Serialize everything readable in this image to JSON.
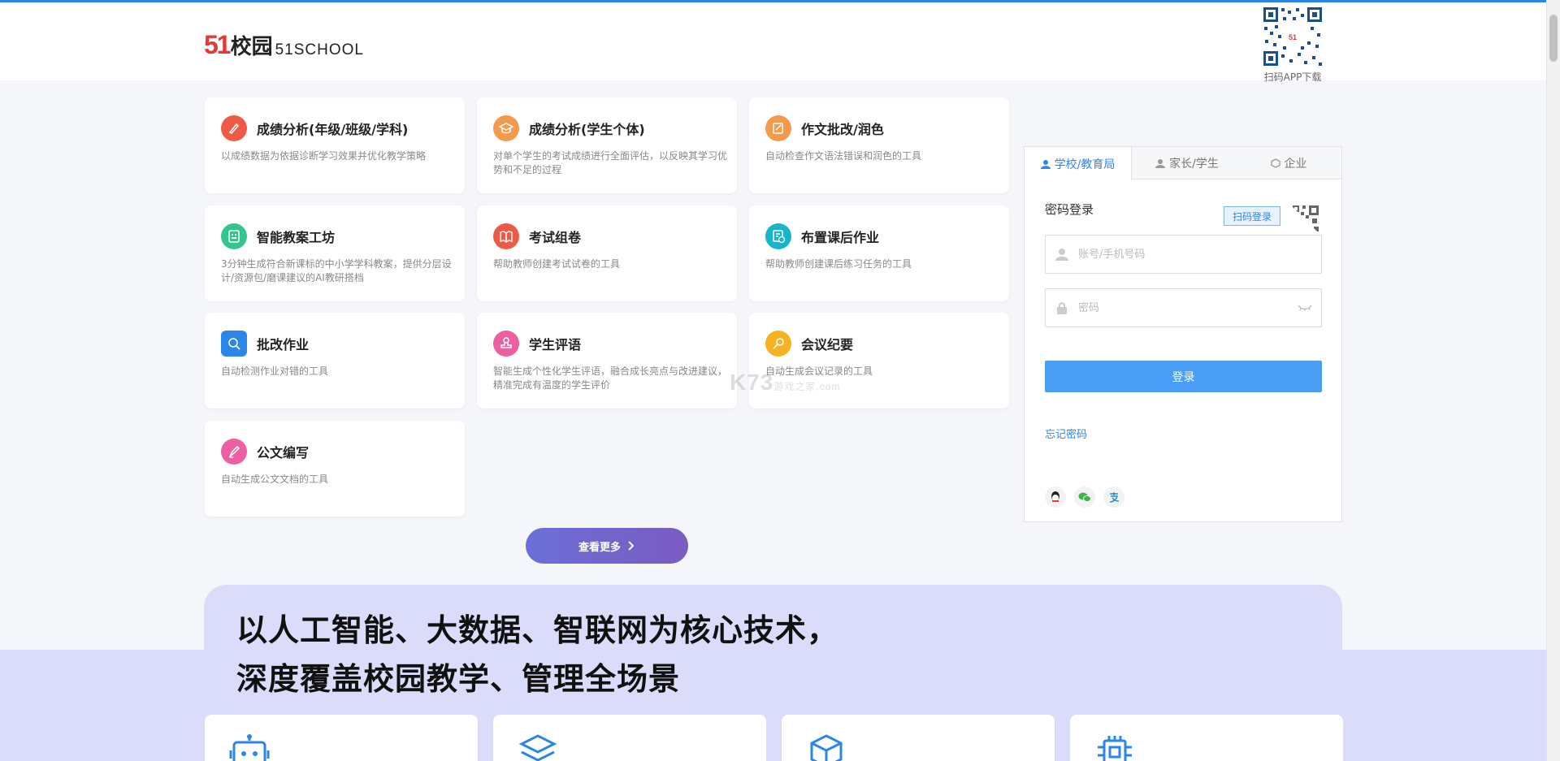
{
  "header": {
    "logo_num": "51",
    "logo_cn": "校园",
    "logo_en": "51SCHOOL",
    "qr_label": "扫码APP下载"
  },
  "tools": [
    {
      "title": "成绩分析(年级/班级/学科)",
      "desc": "以成绩数据为依据诊断学习效果并优化教学策略",
      "icon": "pencil-icon",
      "color": "#ee5a45"
    },
    {
      "title": "成绩分析(学生个体)",
      "desc": "对单个学生的考试成绩进行全面评估，以反映其学习优势和不足的过程",
      "icon": "graduation-cap-icon",
      "color": "#f39a4c"
    },
    {
      "title": "作文批改/润色",
      "desc": "自动检查作文语法错误和润色的工具",
      "icon": "edit-note-icon",
      "color": "#f39a4c"
    },
    {
      "title": "智能教案工坊",
      "desc": "3分钟生成符合新课标的中小学学科教案，提供分层设计/资源包/磨课建议的AI教研搭档",
      "icon": "ai-document-icon",
      "color": "#34c58f"
    },
    {
      "title": "考试组卷",
      "desc": "帮助教师创建考试试卷的工具",
      "icon": "book-icon",
      "color": "#ee5a45"
    },
    {
      "title": "布置课后作业",
      "desc": "帮助教师创建课后练习任务的工具",
      "icon": "homework-clock-icon",
      "color": "#1ab3c9"
    },
    {
      "title": "批改作业",
      "desc": "自动检测作业对错的工具",
      "icon": "search-doc-icon",
      "color": "#2b86e8"
    },
    {
      "title": "学生评语",
      "desc": "智能生成个性化学生评语，融合成长亮点与改进建议，精准完成有温度的学生评价",
      "icon": "stamp-icon",
      "color": "#ec5fa0"
    },
    {
      "title": "会议纪要",
      "desc": "自动生成会议记录的工具",
      "icon": "pen-nib-icon",
      "color": "#f5b324"
    },
    {
      "title": "公文编写",
      "desc": "自动生成公文文档的工具",
      "icon": "quill-icon",
      "color": "#ec5fa0"
    }
  ],
  "more_button": "查看更多",
  "login": {
    "tabs": [
      "学校/教育局",
      "家长/学生",
      "企业"
    ],
    "title": "密码登录",
    "qr_tip": "扫码登录",
    "account_placeholder": "账号/手机号码",
    "password_placeholder": "密码",
    "submit": "登录",
    "forgot": "忘记密码",
    "social": [
      "qq-icon",
      "wechat-icon",
      "alipay-icon"
    ]
  },
  "banner": {
    "line1": "以人工智能、大数据、智联网为核心技术，",
    "line2": "深度覆盖校园教学、管理全场景"
  },
  "features": [
    "robot-icon",
    "layers-icon",
    "cube-icon",
    "chip-icon"
  ],
  "watermark": {
    "main": "K73",
    "sub": "游戏之家",
    "dot": ".com"
  }
}
